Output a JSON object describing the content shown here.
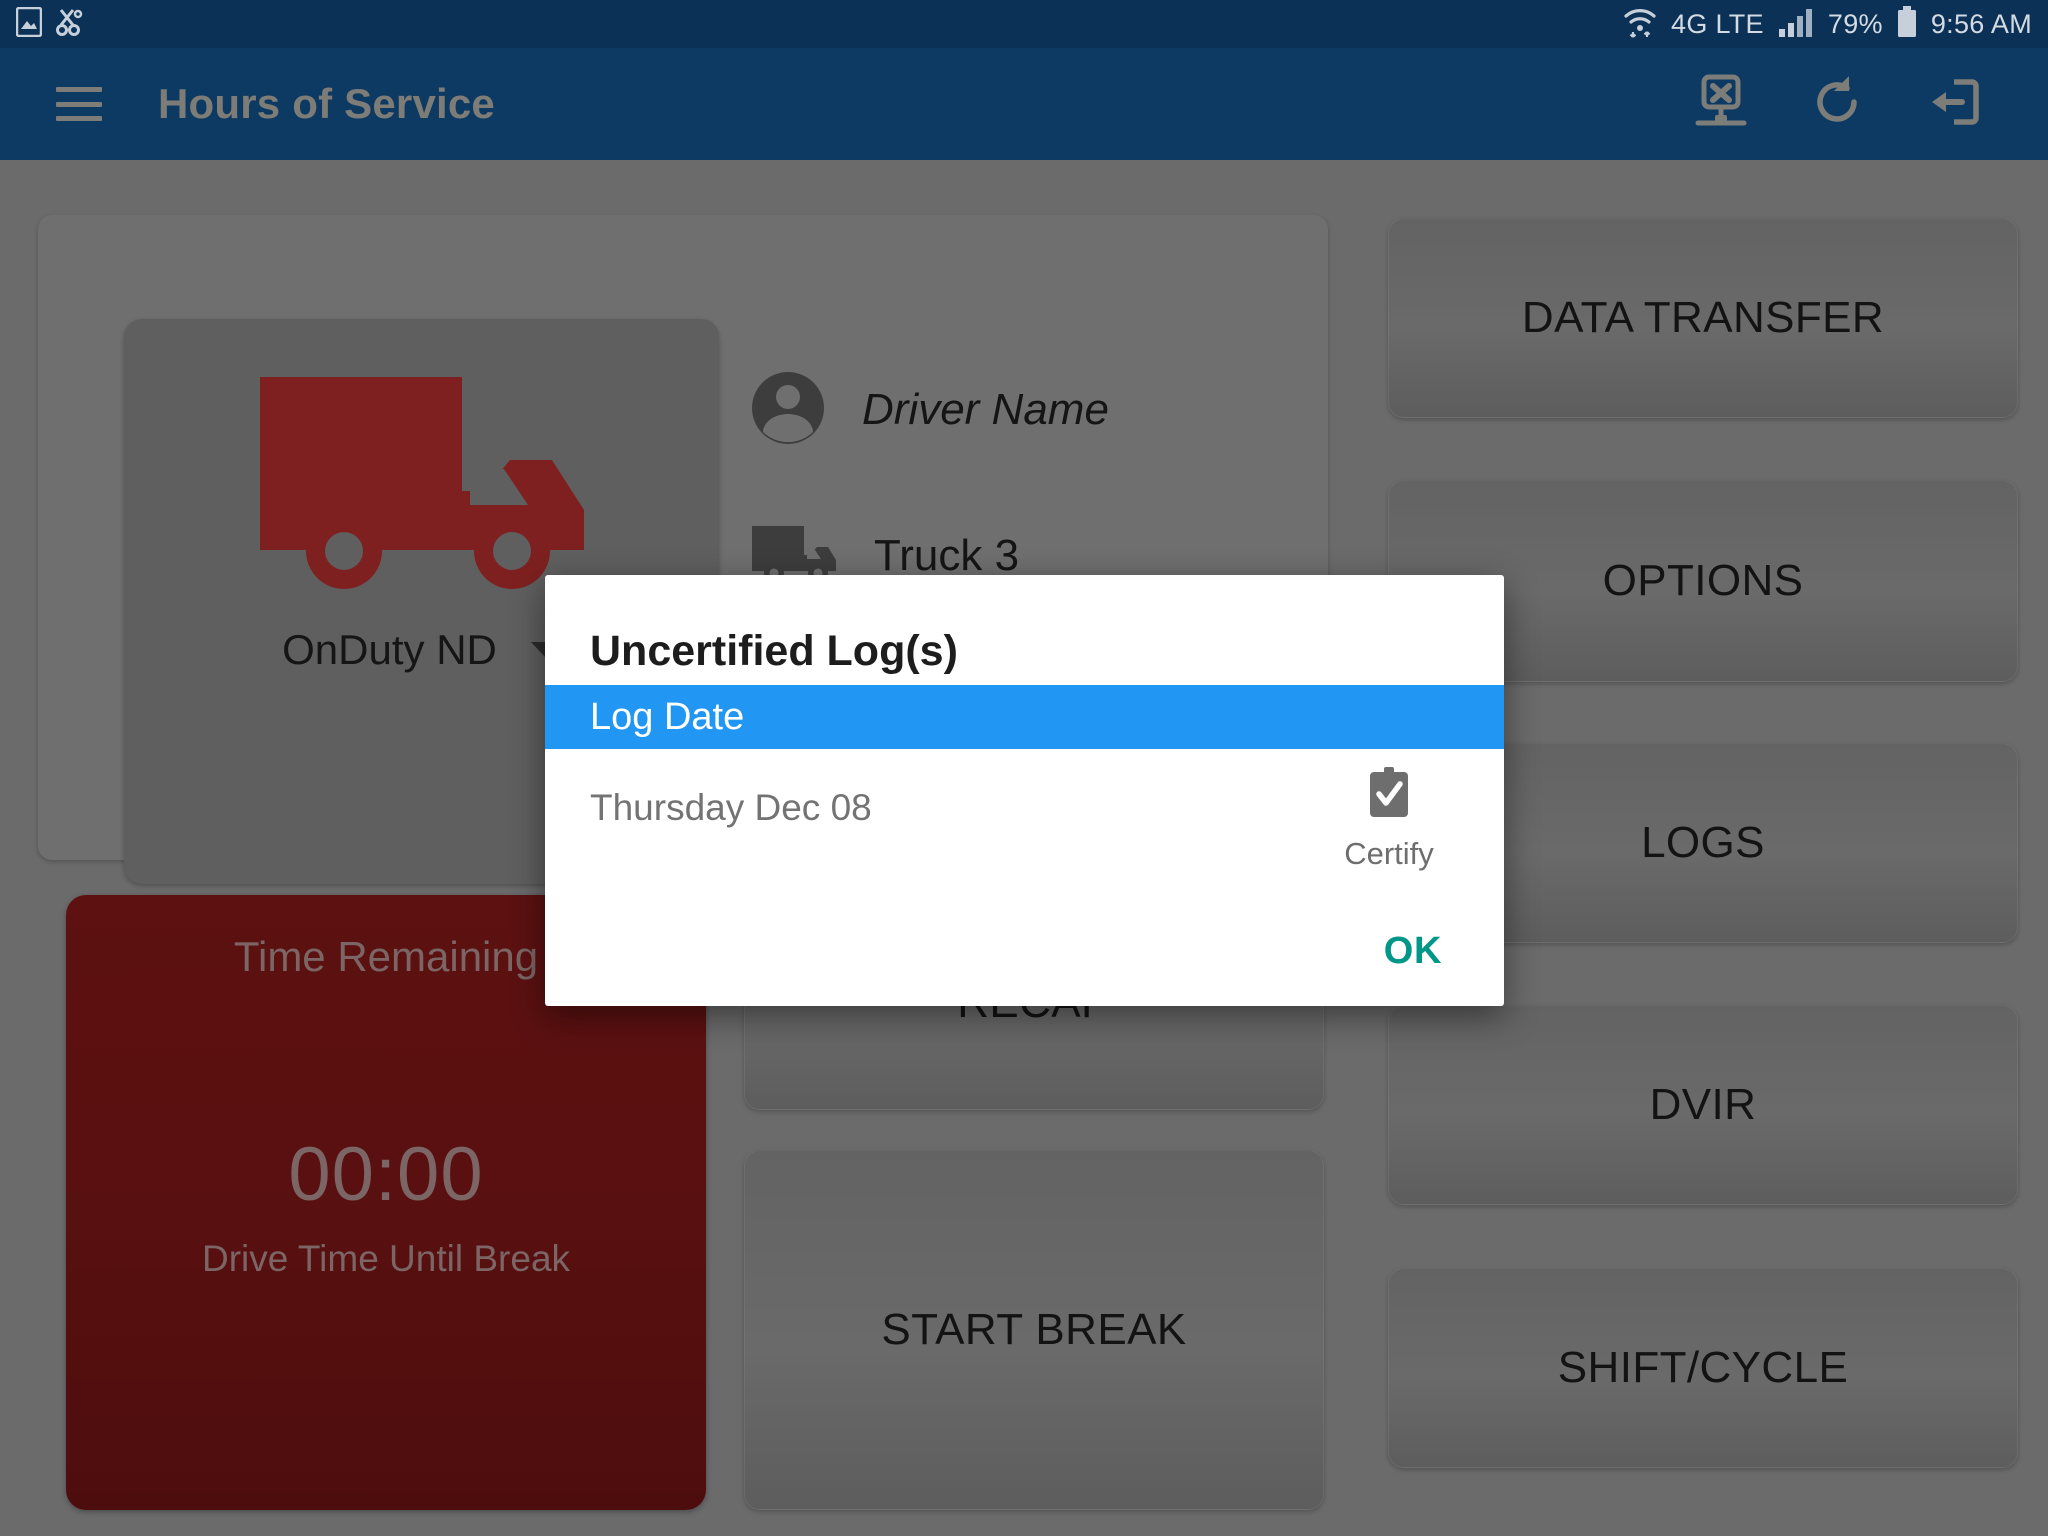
{
  "status_bar": {
    "left_icons": [
      "screenshot-icon",
      "snip-icon"
    ],
    "wifi": "wifi-icon",
    "network": "4G LTE",
    "signal": "signal-bars-icon",
    "battery_percent": "79%",
    "battery": "battery-icon",
    "time": "9:56 AM"
  },
  "app_bar": {
    "menu": "hamburger-menu-icon",
    "title": "Hours of Service",
    "actions": [
      {
        "name": "no-connection-icon"
      },
      {
        "name": "refresh-icon"
      },
      {
        "name": "logout-icon"
      }
    ]
  },
  "main": {
    "status_card": {
      "icon": "truck-icon",
      "duty_status": "OnDuty ND",
      "dropdown": "chevron-down-icon"
    },
    "driver": {
      "avatar": "person-icon",
      "name": "Driver Name",
      "vehicle_icon": "truck-icon",
      "vehicle": "Truck 3"
    },
    "time_remaining": {
      "title": "Time Remaining",
      "value": "00:00",
      "subtitle": "Drive Time Until Break"
    },
    "middle_buttons": [
      {
        "label": "RECAP"
      },
      {
        "label": "START BREAK"
      }
    ],
    "right_buttons": [
      {
        "label": "DATA TRANSFER"
      },
      {
        "label": "OPTIONS"
      },
      {
        "label": "LOGS"
      },
      {
        "label": "DVIR"
      },
      {
        "label": "SHIFT/CYCLE"
      }
    ]
  },
  "dialog": {
    "title": "Uncertified Log(s)",
    "column_header": "Log Date",
    "rows": [
      {
        "date": "Thursday Dec 08",
        "action_icon": "clipboard-check-icon",
        "action_label": "Certify"
      }
    ],
    "ok_label": "OK"
  },
  "colors": {
    "status_bar": "#0c3156",
    "app_bar": "#0d3a63",
    "dim_overlay": "#6b6b6b",
    "accent_blue": "#2196f3",
    "accent_teal": "#009688",
    "time_card_red": "#5a1010",
    "truck_red": "#7e2020"
  }
}
